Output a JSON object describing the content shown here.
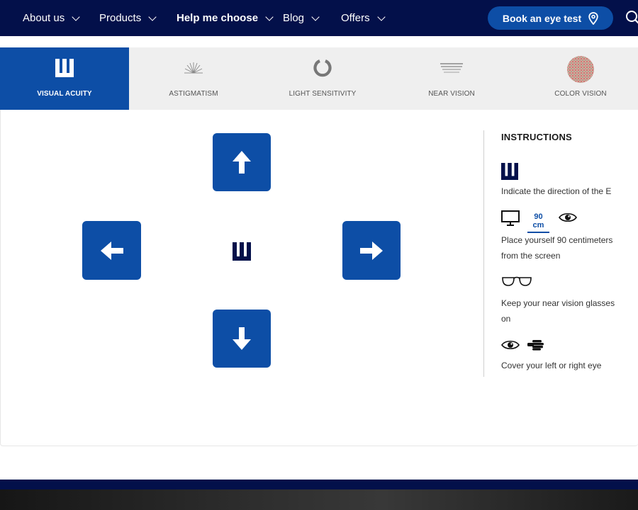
{
  "nav": {
    "items": [
      {
        "label": "About us"
      },
      {
        "label": "Products"
      },
      {
        "label": "Help me choose"
      },
      {
        "label": "Blog"
      },
      {
        "label": "Offers"
      }
    ],
    "book_label": "Book an eye test"
  },
  "tabs": [
    {
      "label": "VISUAL ACUITY",
      "icon": "tumbling-e-icon",
      "active": true
    },
    {
      "label": "ASTIGMATISM",
      "icon": "astigmatism-fan-icon",
      "active": false
    },
    {
      "label": "LIGHT SENSITIVITY",
      "icon": "ring-icon",
      "active": false
    },
    {
      "label": "NEAR VISION",
      "icon": "lines-icon",
      "active": false
    },
    {
      "label": "COLOR VISION",
      "icon": "ishihara-dot-icon",
      "active": false
    }
  ],
  "test": {
    "arrows": [
      "up",
      "left",
      "right",
      "down"
    ],
    "symbol": "tumbling-e"
  },
  "instructions": {
    "title": "INSTRUCTIONS",
    "step1": "Indicate the direction of the E",
    "distance": "90 cm",
    "step2_line1": "Place yourself 90 centimeters",
    "step2_line2": "from the screen",
    "step3_line1": "Keep your near vision glasses",
    "step3_line2": "on",
    "step4": "Cover your left or right eye"
  },
  "colors": {
    "navy": "#03104a",
    "brand_blue": "#0d4ea6",
    "tab_bg": "#efefef"
  }
}
